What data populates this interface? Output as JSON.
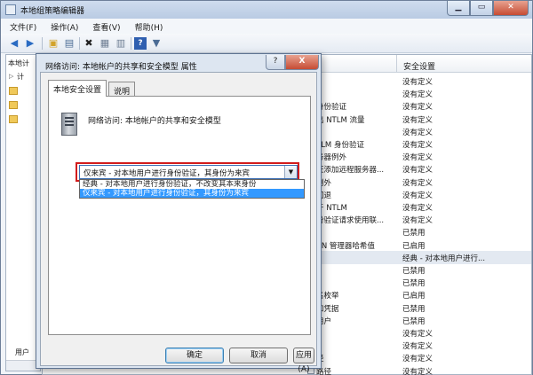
{
  "window": {
    "title": "本地组策略编辑器"
  },
  "menu": [
    "文件(F)",
    "操作(A)",
    "查看(V)",
    "帮助(H)"
  ],
  "toolbar_icons": [
    "back-arrow-icon",
    "forward-arrow-icon",
    "folder-up-icon",
    "show-hide-tree-icon",
    "delete-icon",
    "properties-icon",
    "export-list-icon",
    "help-icon",
    "filter-icon"
  ],
  "tree": {
    "root_label": "本地计",
    "child_label": "计",
    "bottom_label": "用户"
  },
  "list": {
    "column_setting": "安全设置",
    "rows": [
      {
        "name": "",
        "setting": "没有定义"
      },
      {
        "name": "",
        "setting": "没有定义"
      },
      {
        "name": "身份验证",
        "setting": "没有定义"
      },
      {
        "name": "出 NTLM 流量",
        "setting": "没有定义"
      },
      {
        "name": "",
        "setting": "没有定义"
      },
      {
        "name": "TLM 身份验证",
        "setting": "没有定义"
      },
      {
        "name": "务器例外",
        "setting": "没有定义"
      },
      {
        "name": "证添加远程服务器...",
        "setting": "没有定义"
      },
      {
        "name": "例外",
        "setting": "没有定义"
      },
      {
        "name": "回退",
        "setting": "没有定义"
      },
      {
        "name": "于 NTLM",
        "setting": "没有定义"
      },
      {
        "name": "份验证请求使用联...",
        "setting": "没有定义"
      },
      {
        "name": "",
        "setting": "已禁用"
      },
      {
        "name": "AN 管理器哈希值",
        "setting": "已启用"
      },
      {
        "name": "",
        "setting": "经典 - 对本地用户进行..."
      },
      {
        "name": "",
        "setting": "已禁用"
      },
      {
        "name": "",
        "setting": "已禁用"
      },
      {
        "name": "名枚举",
        "setting": "已启用"
      },
      {
        "name": "和凭据",
        "setting": "已禁用"
      },
      {
        "name": "用户",
        "setting": "已禁用"
      },
      {
        "name": "",
        "setting": "没有定义"
      },
      {
        "name": "",
        "setting": "没有定义"
      },
      {
        "name": "径",
        "setting": "没有定义"
      },
      {
        "name": "路径",
        "setting": "没有定义"
      }
    ]
  },
  "dialog": {
    "title": "网络访问: 本地帐户的共享和安全模型 属性",
    "help_label": "?",
    "close_label": "X",
    "tabs": {
      "local": "本地安全设置",
      "explain": "说明"
    },
    "policy_title": "网络访问: 本地帐户的共享和安全模型",
    "combo_value": "仅来宾 - 对本地用户进行身份验证，其身份为来宾",
    "options": [
      "经典 - 对本地用户进行身份验证，不改变其本来身份",
      "仅来宾 - 对本地用户进行身份验证，其身份为来宾"
    ],
    "buttons": {
      "ok": "确定",
      "cancel": "取消",
      "apply": "应用(A)"
    }
  },
  "colors": {
    "highlight_border": "#d21c1c",
    "selected_option": "#3399ff"
  }
}
